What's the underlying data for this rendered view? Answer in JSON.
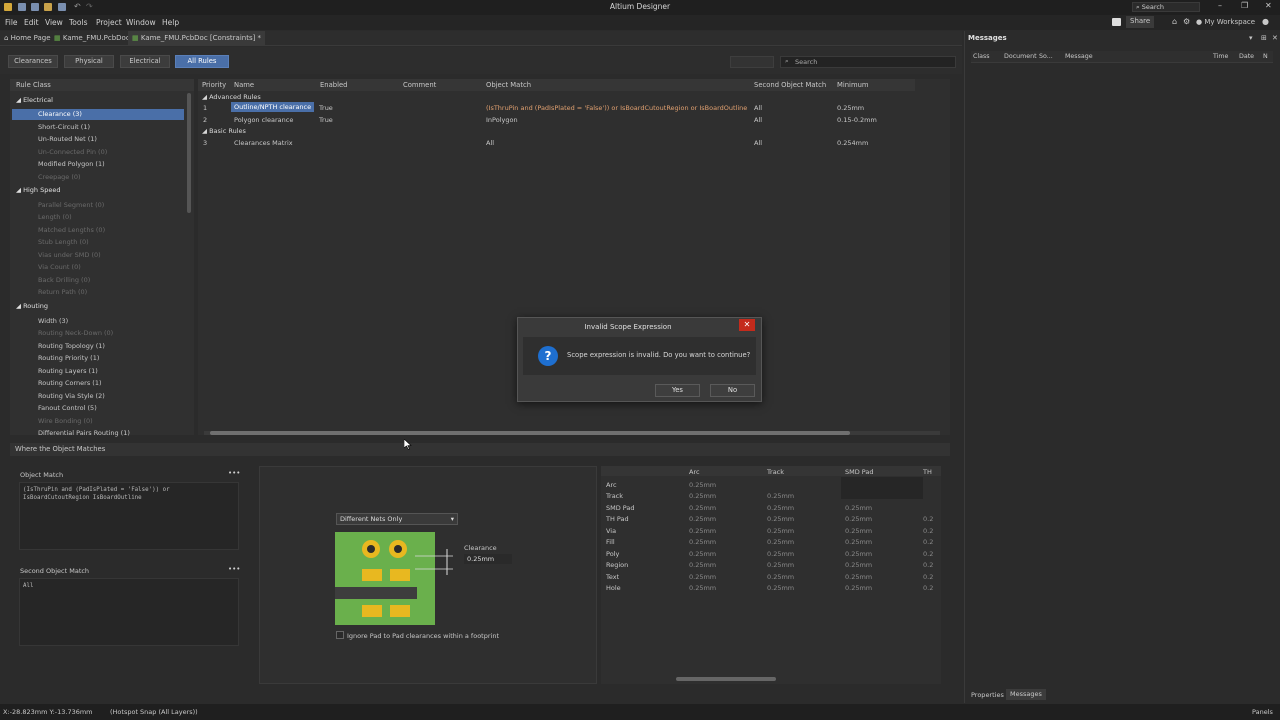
{
  "app": {
    "title": "Altium Designer",
    "search_label": "Search",
    "share_label": "Share",
    "workspace_label": "My Workspace"
  },
  "menu": [
    "File",
    "Edit",
    "View",
    "Tools",
    "Project",
    "Window",
    "Help"
  ],
  "doc_tabs": [
    "Home Page",
    "Kame_FMU.PcbDoc *",
    "Kame_FMU.PcbDoc [Constraints] *"
  ],
  "sub_tabs": [
    "Clearances",
    "Physical",
    "Electrical",
    "All Rules"
  ],
  "toolbar": {
    "search_placeholder": "Search"
  },
  "rule_class": {
    "header": "Rule Class",
    "electrical": {
      "label": "Electrical",
      "items": [
        "Clearance (3)",
        "Short-Circuit (1)",
        "Un-Routed Net (1)",
        "Un-Connected Pin (0)",
        "Modified Polygon (1)",
        "Creepage (0)"
      ]
    },
    "high_speed": {
      "label": "High Speed",
      "items": [
        "Parallel Segment (0)",
        "Length (0)",
        "Matched Lengths (0)",
        "Stub Length (0)",
        "Vias under SMD (0)",
        "Via Count (0)",
        "Back Drilling (0)",
        "Return Path (0)"
      ]
    },
    "routing": {
      "label": "Routing",
      "items": [
        "Width (3)",
        "Routing Neck-Down (0)",
        "Routing Topology (1)",
        "Routing Priority (1)",
        "Routing Layers (1)",
        "Routing Corners (1)",
        "Routing Via Style (2)",
        "Fanout Control (5)",
        "Wire Bonding (0)",
        "Differential Pairs Routing (1)"
      ]
    }
  },
  "rules_grid": {
    "columns": [
      "Priority",
      "Name",
      "Enabled",
      "Comment",
      "Object Match",
      "Second Object Match",
      "Minimum"
    ],
    "groups": [
      {
        "label": "Advanced Rules",
        "rows": [
          {
            "priority": "1",
            "name": "Outline/NPTH clearance",
            "enabled": "True",
            "object_match": "(IsThruPin and (PadIsPlated = 'False')) or IsBoardCutoutRegion or IsBoardOutline",
            "second": "All",
            "minimum": "0.25mm"
          },
          {
            "priority": "2",
            "name": "Polygon clearance",
            "enabled": "True",
            "object_match": "InPolygon",
            "second": "All",
            "minimum": "0.15-0.2mm"
          }
        ]
      },
      {
        "label": "Basic Rules",
        "rows": [
          {
            "priority": "3",
            "name": "Clearances Matrix",
            "enabled": "",
            "object_match": "All",
            "second": "All",
            "minimum": "0.254mm"
          }
        ]
      }
    ]
  },
  "where": {
    "header": "Where the Object Matches",
    "object_match_label": "Object Match",
    "object_match_code_1": "(IsThruPin and (PadIsPlated = 'False')) or",
    "object_match_code_2": "IsBoardCutoutRegion IsBoardOutline",
    "second_match_label": "Second Object Match",
    "second_match_code": "All",
    "dropdown": "Different Nets Only",
    "clearance_label": "Clearance",
    "clearance_value": "0.25mm",
    "ignore_label": "Ignore Pad to Pad clearances within a footprint"
  },
  "matrix": {
    "columns": [
      "Arc",
      "Track",
      "SMD Pad",
      "TH"
    ],
    "rows": [
      {
        "label": "Arc",
        "cells": [
          "0.25mm",
          "",
          "",
          ""
        ]
      },
      {
        "label": "Track",
        "cells": [
          "0.25mm",
          "0.25mm",
          "",
          ""
        ]
      },
      {
        "label": "SMD Pad",
        "cells": [
          "0.25mm",
          "0.25mm",
          "0.25mm",
          ""
        ]
      },
      {
        "label": "TH Pad",
        "cells": [
          "0.25mm",
          "0.25mm",
          "0.25mm",
          "0.2"
        ]
      },
      {
        "label": "Via",
        "cells": [
          "0.25mm",
          "0.25mm",
          "0.25mm",
          "0.2"
        ]
      },
      {
        "label": "Fill",
        "cells": [
          "0.25mm",
          "0.25mm",
          "0.25mm",
          "0.2"
        ]
      },
      {
        "label": "Poly",
        "cells": [
          "0.25mm",
          "0.25mm",
          "0.25mm",
          "0.2"
        ]
      },
      {
        "label": "Region",
        "cells": [
          "0.25mm",
          "0.25mm",
          "0.25mm",
          "0.2"
        ]
      },
      {
        "label": "Text",
        "cells": [
          "0.25mm",
          "0.25mm",
          "0.25mm",
          "0.2"
        ]
      },
      {
        "label": "Hole",
        "cells": [
          "0.25mm",
          "0.25mm",
          "0.25mm",
          "0.2"
        ]
      }
    ]
  },
  "messages": {
    "title": "Messages",
    "columns": [
      "Class",
      "Document",
      "So...",
      "Message",
      "Time",
      "Date",
      "N"
    ],
    "bottom_tabs": [
      "Properties",
      "Messages"
    ]
  },
  "dialog": {
    "title": "Invalid Scope Expression",
    "message": "Scope expression is invalid. Do you want to continue?",
    "yes": "Yes",
    "no": "No"
  },
  "status": {
    "coords": "X:-28.823mm Y:-13.736mm",
    "snap": "(Hotspot Snap (All Layers))",
    "panels": "Panels"
  },
  "colors": {
    "accent": "#4a6fa8",
    "pcb_green": "#6ab04c",
    "pad_gold": "#e8b820",
    "close_red": "#c42b1c",
    "info_blue": "#1e6fd0"
  }
}
